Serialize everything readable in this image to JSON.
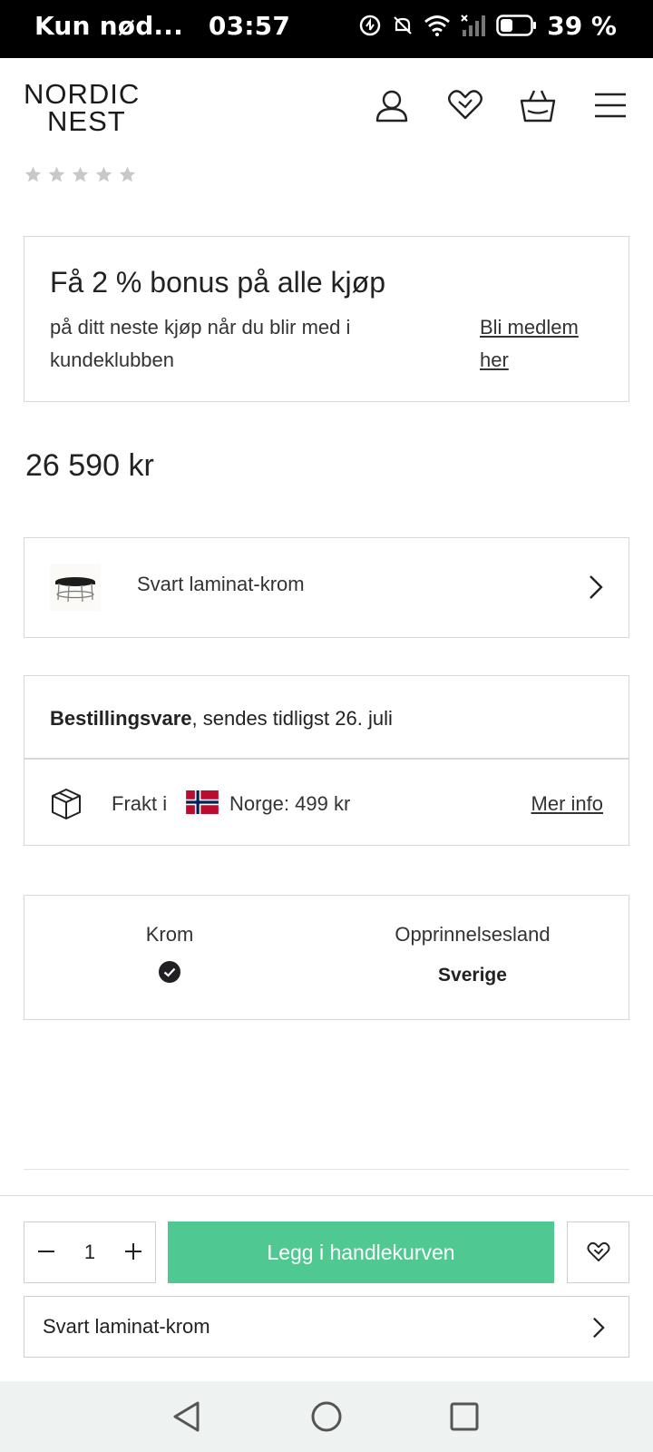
{
  "status_bar": {
    "carrier": "Kun nød...",
    "time": "03:57",
    "battery": "39 %",
    "icons": [
      "data-saver-icon",
      "mute-icon",
      "wifi-icon",
      "signal-icon",
      "battery-icon"
    ]
  },
  "header": {
    "logo_line1": "NORDIC",
    "logo_line2": "NEST",
    "icons": [
      "account-icon",
      "wishlist-icon",
      "basket-icon",
      "menu-icon"
    ]
  },
  "rating": {
    "stars": 5,
    "filled": 0
  },
  "bonus": {
    "title": "Få 2 % bonus på alle kjøp",
    "description": "på ditt neste kjøp når du blir med i kundeklubben",
    "link": "Bli medlem her"
  },
  "price": "26 590 kr",
  "variant_selector": {
    "label": "Svart laminat-krom"
  },
  "delivery": {
    "status_bold": "Bestillingsvare",
    "status_rest": ", sendes tidligst 26. juli",
    "shipping_prefix": "Frakt i",
    "shipping_country": "Norge: 499 kr",
    "more_info": "Mer info"
  },
  "specs": {
    "material_label": "Krom",
    "origin_label": "Opprinnelsesland",
    "origin_value": "Sverige"
  },
  "sticky_bar": {
    "quantity": "1",
    "add_to_cart": "Legg i handlekurven",
    "variant_label": "Svart laminat-krom"
  },
  "colors": {
    "accent_green": "#4fc891",
    "border": "#d8d8d8",
    "text": "#222222",
    "navbar_bg": "#eef3f1"
  }
}
